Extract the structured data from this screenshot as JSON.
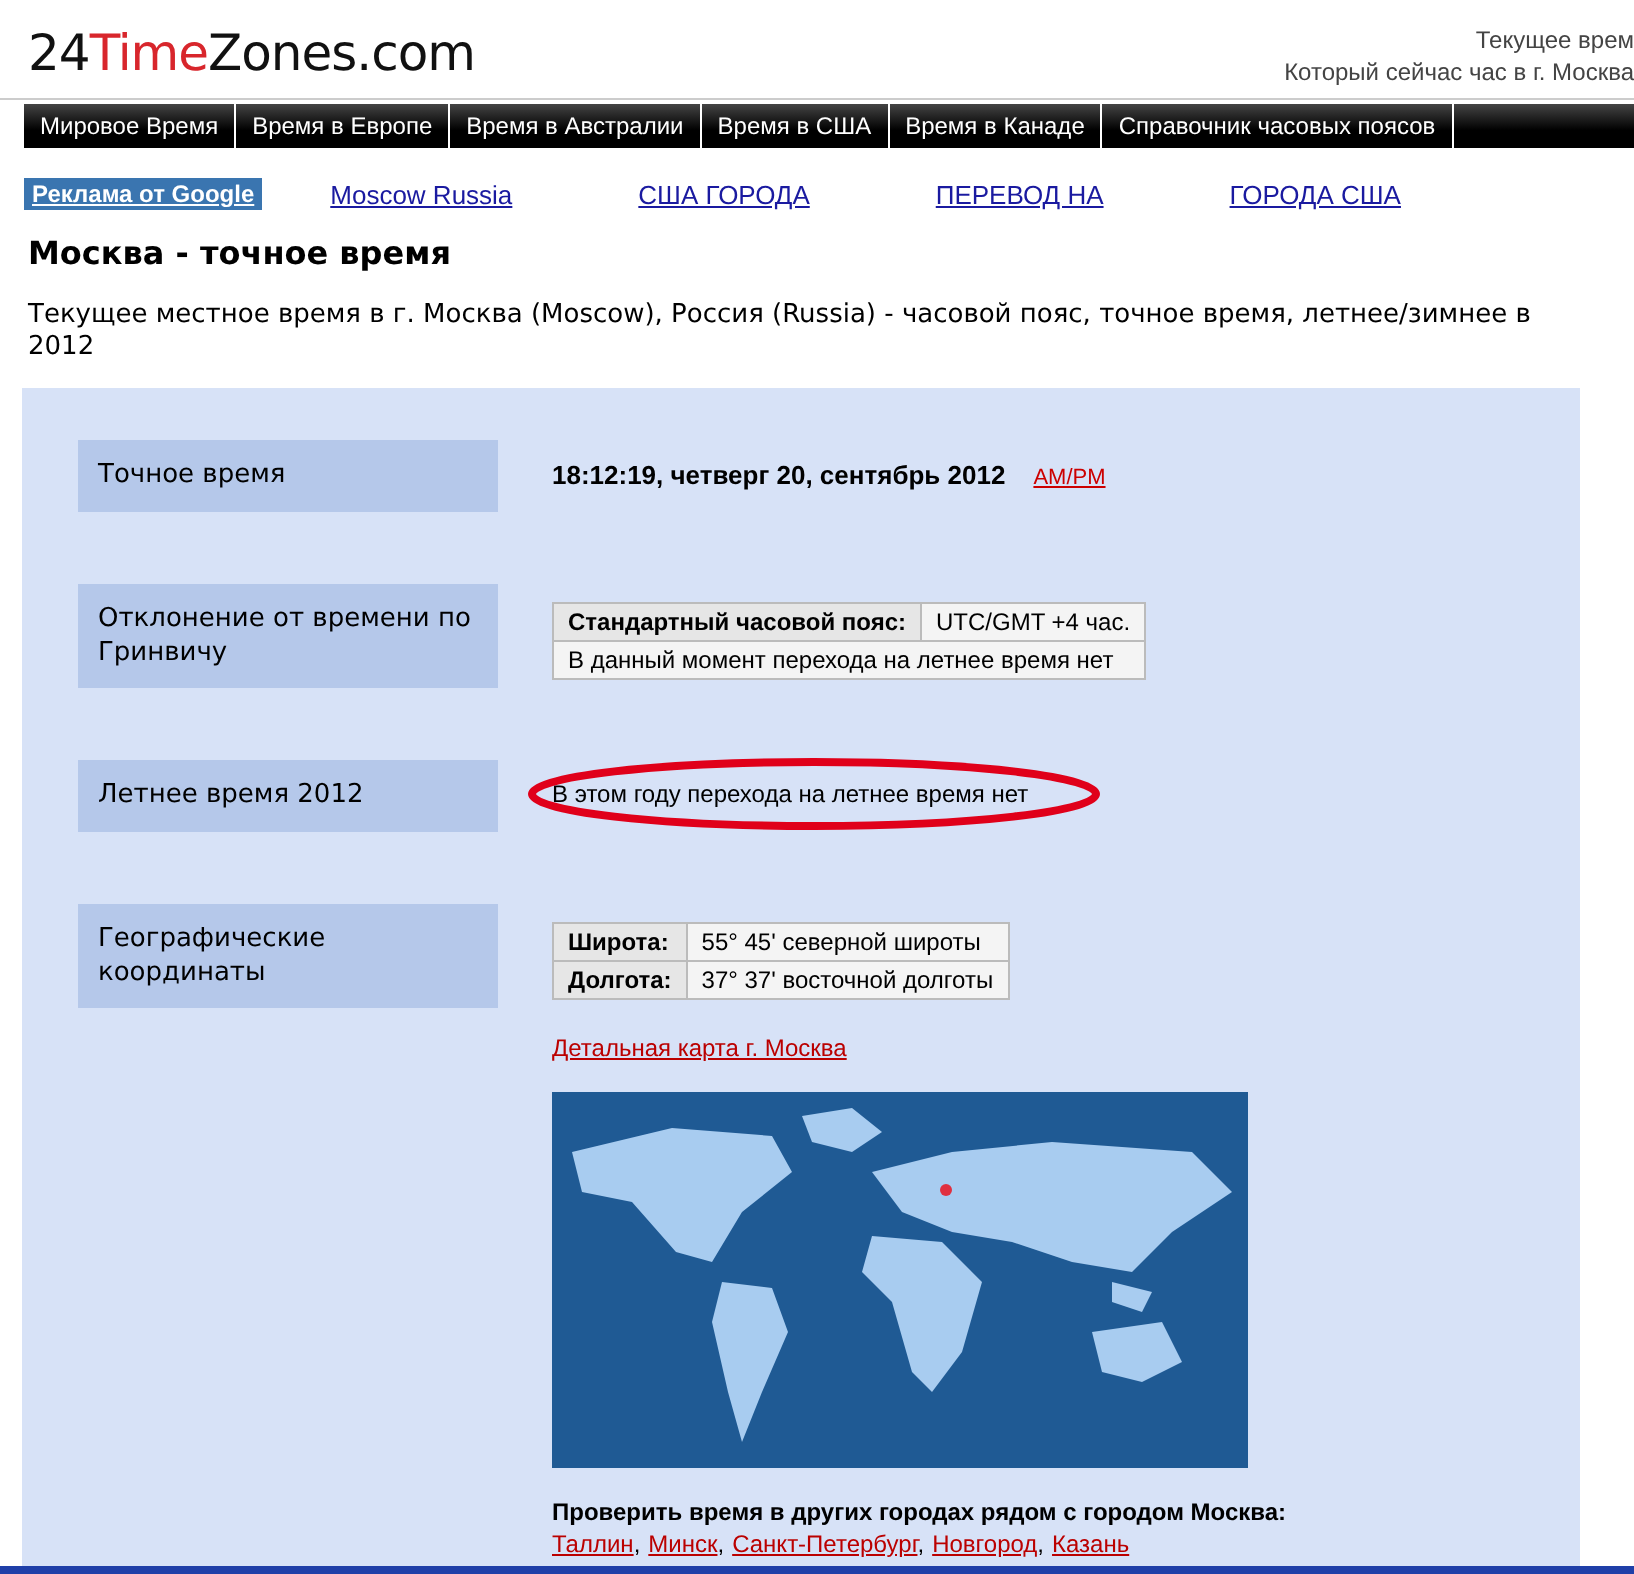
{
  "logo": {
    "prefix": "24",
    "accent": "Time",
    "suffix": "Zones.com"
  },
  "header_right": [
    "Текущее врем",
    "Который сейчас час в г. Москва"
  ],
  "nav": [
    "Мировое Время",
    "Время в Европе",
    "Время в Австралии",
    "Время в США",
    "Время в Канаде",
    "Справочник часовых поясов"
  ],
  "ad_label": "Реклама от Google",
  "ad_links": [
    "Moscow Russia",
    "США ГОРОДА",
    "ПЕРЕВОД НА",
    "ГОРОДА США"
  ],
  "title": "Москва - точное время",
  "description": "Текущее местное время в г. Москва (Moscow), Россия (Russia) - часовой пояс, точное время, летнее/зимнее в 2012",
  "sections": [
    {
      "kind": "time",
      "label": "Точное время",
      "value": "18:12:19, четверг 20, сентябрь 2012",
      "link": "AM/PM"
    },
    {
      "kind": "offset",
      "label": "Отклонение от времени по Гринвичу",
      "rows": [
        [
          {
            "text": "Стандартный часовой пояс:",
            "header": true
          },
          {
            "text": "UTC/GMT +4 час."
          }
        ],
        [
          {
            "text": "В данный момент перехода на летнее время нет",
            "colspan": 2
          }
        ]
      ]
    },
    {
      "kind": "dst",
      "label": "Летнее время 2012",
      "value": "В этом году перехода на летнее время нет",
      "highlighted": true
    },
    {
      "kind": "coords",
      "label": "Географические координаты",
      "rows": [
        [
          {
            "text": "Широта:",
            "header": true
          },
          {
            "text": "55° 45' северной широты"
          }
        ],
        [
          {
            "text": "Долгота:",
            "header": true
          },
          {
            "text": "37° 37' восточной долготы"
          }
        ]
      ],
      "link": "Детальная карта г. Москва"
    }
  ],
  "nearby": {
    "lead": "Проверить время в других городах рядом с городом Москва:",
    "cities": [
      "Таллин",
      "Минск",
      "Санкт-Петербург",
      "Новгород",
      "Казань"
    ],
    "separator": ","
  }
}
